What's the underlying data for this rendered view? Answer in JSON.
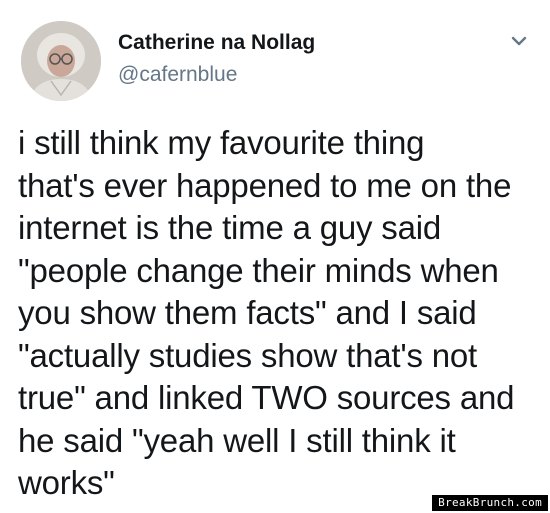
{
  "tweet": {
    "author": {
      "display_name": "Catherine na Nollag",
      "handle": "@cafernblue"
    },
    "menu_icon": "chevron-down-icon",
    "avatar_icon": "avatar",
    "text_lines": [
      "i still think my favourite thing",
      "that's ever happened to me on the",
      "internet is the time a guy said",
      "\"people change their minds when",
      "you show them facts\" and I said",
      "\"actually studies show that's not",
      "true\" and linked TWO sources and",
      "he said \"yeah well I still think it",
      "works\""
    ]
  },
  "watermark": {
    "text": "BreakBrunch.com"
  },
  "colors": {
    "text": "#14171a",
    "handle": "#657786",
    "background": "#ffffff",
    "watermark_bg": "#000000",
    "watermark_text": "#ffffff"
  }
}
